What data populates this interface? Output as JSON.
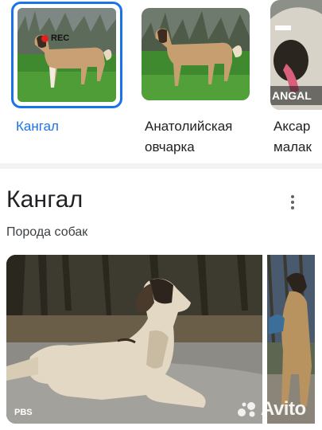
{
  "carousel": {
    "items": [
      {
        "label": "Кангал",
        "overlay": "REC"
      },
      {
        "label_line1": "Анатолийская",
        "label_line2": "овчарка"
      },
      {
        "label_line1": "Аксар",
        "label_line2": "малак",
        "photo_text": "ANGAL"
      }
    ]
  },
  "panel": {
    "title": "Кангал",
    "subtitle": "Порода собак",
    "photo_credit": "PBS"
  },
  "watermark": {
    "text": "Avito"
  },
  "colors": {
    "accent": "#1a73e8",
    "rec": "#e02020"
  },
  "icons": [
    "more-vert-icon",
    "avito-logo-icon"
  ]
}
